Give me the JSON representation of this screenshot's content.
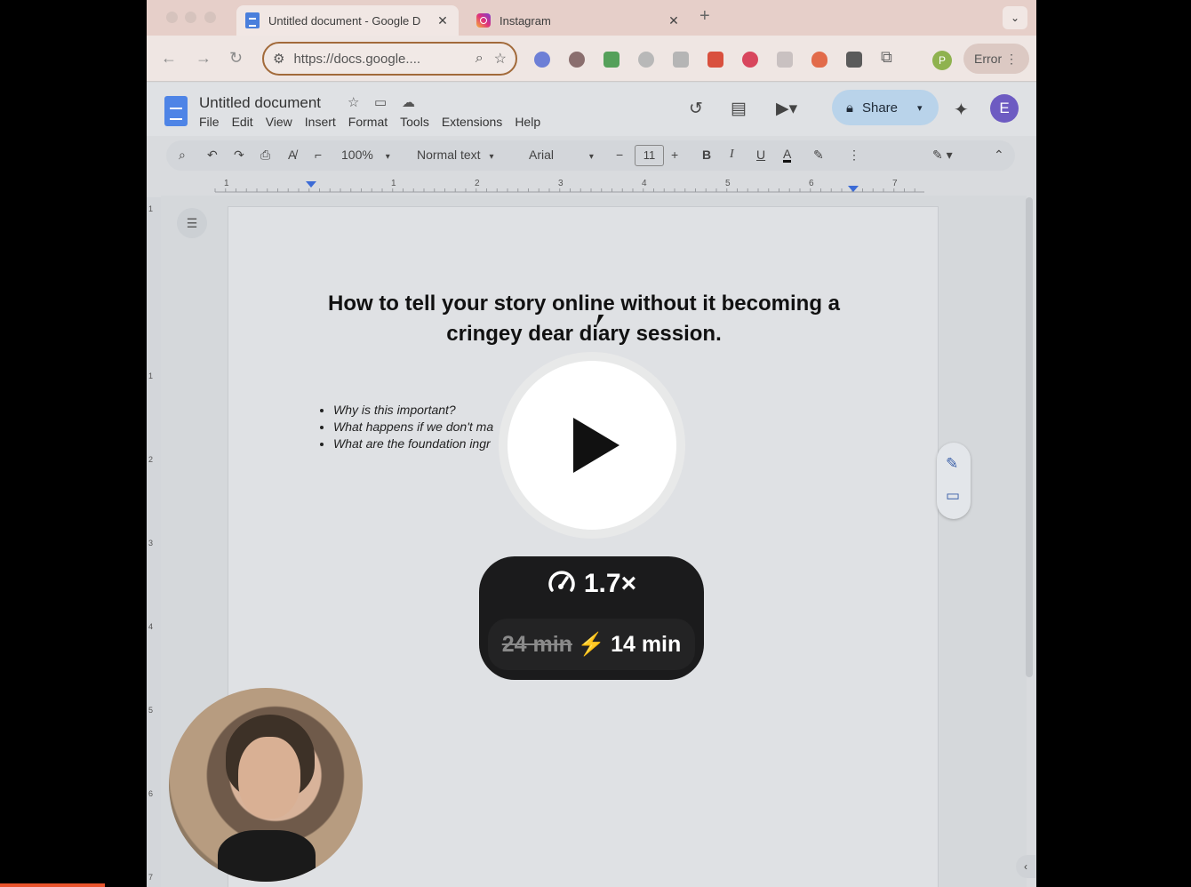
{
  "browser": {
    "tabs": [
      {
        "title": "Untitled document - Google D",
        "close": "✕"
      },
      {
        "title": "Instagram",
        "close": "✕"
      }
    ],
    "new_tab": "+",
    "tab_menu": "⌄",
    "url": "https://docs.google....",
    "profile_initial": "P",
    "error_label": "Error"
  },
  "docs": {
    "title": "Untitled document",
    "menu": [
      "File",
      "Edit",
      "View",
      "Insert",
      "Format",
      "Tools",
      "Extensions",
      "Help"
    ],
    "share_label": "Share",
    "avatar_initial": "E",
    "toolbar": {
      "zoom": "100%",
      "style": "Normal text",
      "font": "Arial",
      "font_size": "11",
      "bold": "B",
      "italic": "I",
      "underline": "U",
      "text_color": "A"
    },
    "ruler_marks": [
      "1",
      "1",
      "2",
      "3",
      "4",
      "5",
      "6",
      "7"
    ],
    "vruler_marks": [
      "1",
      "1",
      "2",
      "3",
      "4",
      "5",
      "6",
      "7"
    ],
    "heading": "How to tell your story online without it becoming a cringey dear diary session.",
    "bullets": [
      "Why is this important?",
      "What happens if we don't ma",
      "What are the foundation ingr"
    ]
  },
  "overlay": {
    "speed": "1.7×",
    "original_time": "24 min",
    "bolt": "⚡",
    "new_time": "14 min"
  },
  "colors": {
    "accent": "#4e84e6",
    "share_bg": "#b9d3ea",
    "progress": "#e8532c",
    "avatar": "#6d5bc2"
  }
}
